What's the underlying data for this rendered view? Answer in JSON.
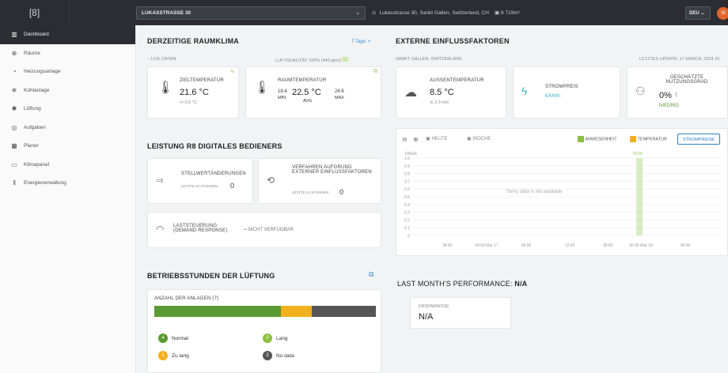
{
  "topbar": {
    "logo": "[8]",
    "site": "LUKASSTRASSE 30",
    "address": "Lukasstrasse 30, Sankt Gallen, Switzerland, CH",
    "area": "6 719m²",
    "language": "DEU",
    "avatar": "SI"
  },
  "sidebar": {
    "items": [
      {
        "label": "Dashboard",
        "icon": "▥"
      },
      {
        "label": "Räume",
        "icon": "⊕"
      },
      {
        "label": "Heizungsanlage",
        "icon": "◔"
      },
      {
        "label": "Kühlanlage",
        "icon": "❄"
      },
      {
        "label": "Lüftung",
        "icon": "✺"
      },
      {
        "label": "Aufgaben",
        "icon": "◎"
      },
      {
        "label": "Planer",
        "icon": "▦"
      },
      {
        "label": "Klimapanel",
        "icon": "▭"
      },
      {
        "label": "Energieverwaltung",
        "icon": "⫴"
      }
    ]
  },
  "klima": {
    "title": "DERZEITIGE RAUMKLIMA",
    "range_link": "7 Tage ↗",
    "live": "LIVE DATEN",
    "air_quality": "LUFTQUALITÄT 100% (440 ppm)",
    "ziel_label": "ZIELTEMPERATUR",
    "ziel_value": "21.6 °C",
    "ziel_delta": "+/-0.5 °C",
    "raum_label": "RAUMTEMPERATUR",
    "raum_min": "18.4",
    "raum_min_label": "MIN",
    "raum_avg": "22.5 °C",
    "raum_avg_label": "AVG",
    "raum_max": "24.6",
    "raum_max_label": "MAX"
  },
  "extern": {
    "title": "EXTERNE EINFLUSSFAKTOREN",
    "location": "SANKT GALLEN, SWITZERLAND",
    "update": "LETZTES UPDATE: 17 MARCH, 2024 20:",
    "aussen_label": "AUSSENTEMPERATUR",
    "aussen_value": "8.5 °C",
    "wind": "2.3 m/s",
    "strom_label": "STROMPREIS",
    "strom_value": "€/MWh",
    "nutz_label": "GESCHÄTZTE NUTZUNGSGRAD",
    "nutz_value": "0%",
    "nutz_level": "NIEDRIG"
  },
  "leistung": {
    "title": "LEISTUNG R8 DIGITALES BEDIENERS",
    "stell_label": "STELLWERTÄNDERUNGEN",
    "stell_sub": "LETZTE 24 STUNDEN",
    "stell_value": "0",
    "verf_label": "VERFAHREN AUFGRUND EXTERNER EINFLUSSFAKTOREN",
    "verf_sub": "LETZTE 24 STUNDEN",
    "verf_value": "0",
    "last_label": "LASTSTEUERUNG (DEMAND RESPONSE)",
    "last_value": "NICHT VERFÜGBAR"
  },
  "betrieb": {
    "title": "BETRIEBSSTUNDEN DER LÜFTUNG",
    "count_label": "ANZAHL DER ANLAGEN (7)",
    "legend": [
      {
        "num": "4",
        "label": "Normal",
        "color": "#5a9a32"
      },
      {
        "num": "0",
        "label": "Lang",
        "color": "#8cbf3f"
      },
      {
        "num": "1",
        "label": "Zu lang",
        "color": "#f2b01e"
      },
      {
        "num": "2",
        "label": "No data",
        "color": "#555555"
      }
    ]
  },
  "chart": {
    "today": "HEUTE",
    "week": "WOCHE",
    "legend_presence": "ANWESENHEIT",
    "legend_temp": "TEMPERATUR",
    "legend_price": "STROMPREISE",
    "unit": "€/Mwh",
    "now": "NOW",
    "no_data": "Sorry, data is not available"
  },
  "chart_data": {
    "type": "line",
    "ylabel": "€/Mwh",
    "yticks": [
      "1.0",
      "0.9",
      "0.8",
      "0.7",
      "0.6",
      "0.5",
      "0.4",
      "0.3",
      "0.2",
      "0.1",
      "0"
    ],
    "xticks": [
      "18:00",
      "00:00 Mar 17",
      "06:00",
      "12:00",
      "18:00",
      "00:00 Mar 18",
      "06:00"
    ],
    "ylim": [
      0,
      1
    ],
    "series": []
  },
  "performance": {
    "title": "LAST MONTH'S PERFORMANCE:",
    "title_value": "N/A",
    "savings_label": "ERSPARNISSE",
    "savings_value": "N/A"
  }
}
